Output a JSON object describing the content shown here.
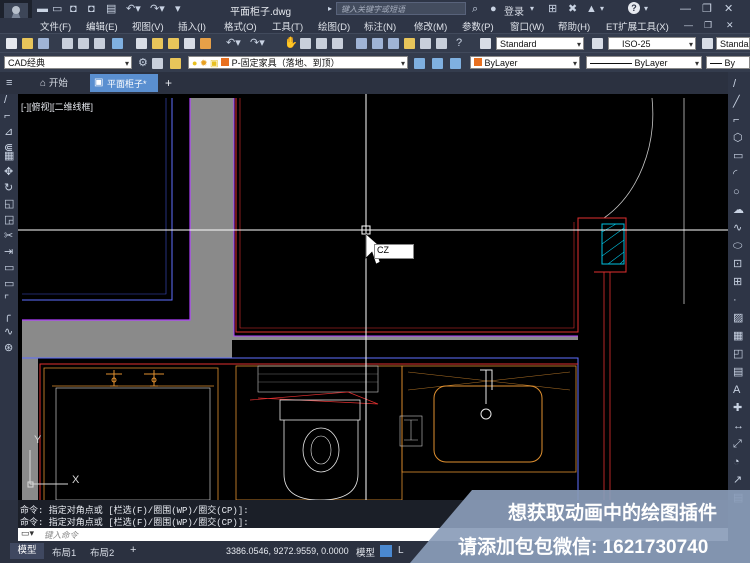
{
  "title_bar": {
    "document_name": "平面柜子.dwg",
    "search_placeholder": "键入关键字或短语",
    "login_label": "登录",
    "help_icon": "?"
  },
  "menu": [
    "文件(F)",
    "编辑(E)",
    "视图(V)",
    "插入(I)",
    "格式(O)",
    "工具(T)",
    "绘图(D)",
    "标注(N)",
    "修改(M)",
    "参数(P)",
    "窗口(W)",
    "帮助(H)",
    "ET扩展工具(X)"
  ],
  "toolbar1": {
    "text_style": "Standard",
    "dim_style": "ISO-25",
    "table_style": "Standard"
  },
  "toolbar2": {
    "workspace": "CAD经典",
    "layer": "P-固定家具（落地、到顶）",
    "color": "ByLayer",
    "linetype": "ByLayer",
    "lineweight": "By"
  },
  "tabs": {
    "start_label": "开始",
    "active_tab": "平面柜子*",
    "add": "+"
  },
  "viewport_label": "[-][俯视][二维线框]",
  "cursor_input": "CZ",
  "command": {
    "line1": "命令: 指定对角点或 [栏选(F)/圈围(WP)/圈交(CP)]:",
    "line2": "命令: 指定对角点或 [栏选(F)/圈围(WP)/圈交(CP)]:",
    "input_placeholder": "键入命令"
  },
  "layout_tabs": [
    "模型",
    "布局1",
    "布局2"
  ],
  "status": {
    "coordinates": "3386.0546, 9272.9559, 0.0000",
    "model_label": "模型"
  },
  "watermark": {
    "line1": "想获取动画中的绘图插件",
    "line2": "请添加包包微信: 1621730740"
  },
  "ucs": {
    "x": "X",
    "y": "Y"
  }
}
